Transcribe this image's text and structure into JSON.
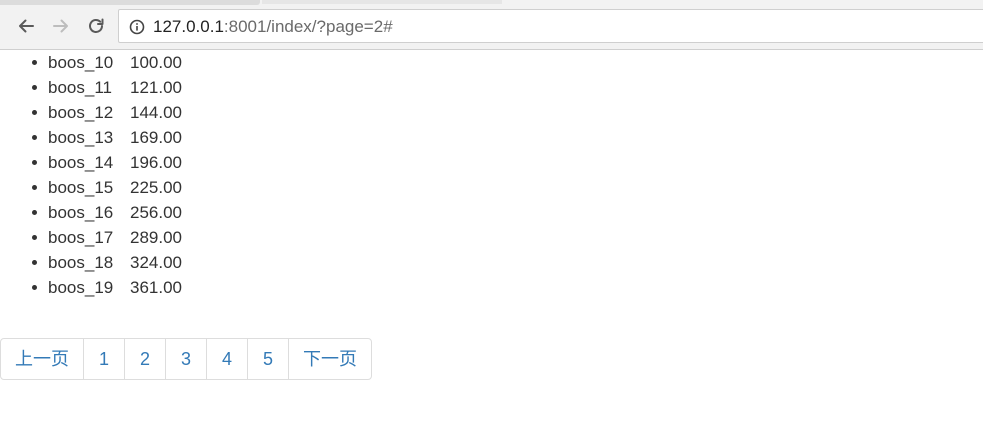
{
  "browser": {
    "url_host": "127.0.0.1",
    "url_path": ":8001/index/?page=2#"
  },
  "items": [
    {
      "name": "boos_10",
      "value": "100.00"
    },
    {
      "name": "boos_11",
      "value": "121.00"
    },
    {
      "name": "boos_12",
      "value": "144.00"
    },
    {
      "name": "boos_13",
      "value": "169.00"
    },
    {
      "name": "boos_14",
      "value": "196.00"
    },
    {
      "name": "boos_15",
      "value": "225.00"
    },
    {
      "name": "boos_16",
      "value": "256.00"
    },
    {
      "name": "boos_17",
      "value": "289.00"
    },
    {
      "name": "boos_18",
      "value": "324.00"
    },
    {
      "name": "boos_19",
      "value": "361.00"
    }
  ],
  "pagination": {
    "prev_label": "上一页",
    "pages": [
      "1",
      "2",
      "3",
      "4",
      "5"
    ],
    "next_label": "下一页",
    "link_color": "#337ab7"
  }
}
